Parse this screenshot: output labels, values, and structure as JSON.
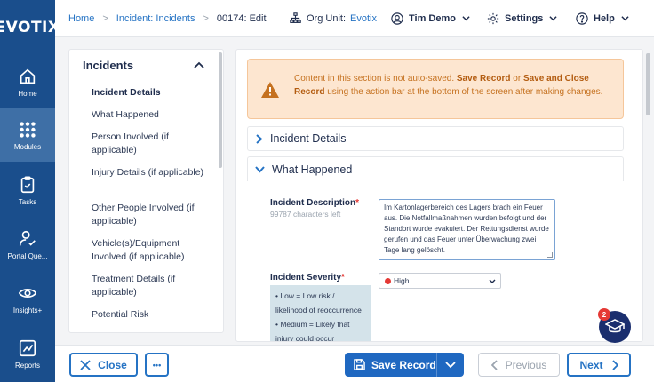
{
  "app": {
    "logo": "EVOTIX"
  },
  "rail": {
    "items": [
      {
        "label": "Home",
        "icon": "home-icon"
      },
      {
        "label": "Modules",
        "icon": "grid-icon",
        "active": true
      },
      {
        "label": "Tasks",
        "icon": "clipboard-icon"
      },
      {
        "label": "Portal Que...",
        "icon": "person-check-icon"
      },
      {
        "label": "Insights+",
        "icon": "eye-icon"
      },
      {
        "label": "Reports",
        "icon": "chart-icon"
      }
    ]
  },
  "topbar": {
    "breadcrumb": [
      {
        "label": "Home",
        "link": true
      },
      {
        "label": "Incident: Incidents",
        "link": true
      },
      {
        "label": "00174: Edit",
        "link": false
      }
    ],
    "org_unit_label": "Org Unit:",
    "org_unit_value": "Evotix",
    "user": "Tim Demo",
    "settings": "Settings",
    "help": "Help"
  },
  "nav": {
    "title": "Incidents",
    "items": [
      {
        "label": "Incident Details",
        "active": true
      },
      {
        "label": "What Happened"
      },
      {
        "label": "Person Involved (if applicable)"
      },
      {
        "label": "Injury Details (if applicable)"
      },
      {
        "label": "Other People Involved (if applicable)"
      },
      {
        "label": "Vehicle(s)/Equipment Involved (if applicable)"
      },
      {
        "label": "Treatment Details (if applicable)"
      },
      {
        "label": "Potential Risk"
      }
    ]
  },
  "warning": {
    "text_1": "Content in this section is not auto-saved. ",
    "bold_1": "Save Record",
    "text_2": " or ",
    "bold_2": "Save and Close Record",
    "text_3": " using the action bar at the bottom of the screen after making changes."
  },
  "sections": {
    "incident_details": "Incident Details",
    "what_happened": "What Happened"
  },
  "form": {
    "description_label": "Incident Description",
    "description_counter": "99787 characters left",
    "description_value": "Im Kartonlagerbereich des Lagers brach ein Feuer aus. Die Notfallmaßnahmen wurden befolgt und der Standort wurde evakuiert. Der Rettungsdienst wurde gerufen und das Feuer unter Überwachung zwei Tage lang gelöscht.",
    "severity_label": "Incident Severity",
    "severity_value": "High",
    "severity_color": "#e53935",
    "severity_help": [
      "• Low = Low risk / likelihood of reoccurrence",
      "• Medium = Likely that injury could occur"
    ]
  },
  "actions": {
    "close": "Close",
    "more": "•••",
    "save": "Save Record",
    "previous": "Previous",
    "next": "Next"
  },
  "fab": {
    "badge": "2",
    "icon": "graduation-cap-icon"
  },
  "colors": {
    "rail": "#1a4e8c",
    "accent": "#2573c4",
    "warning_bg": "#fde6d0"
  }
}
